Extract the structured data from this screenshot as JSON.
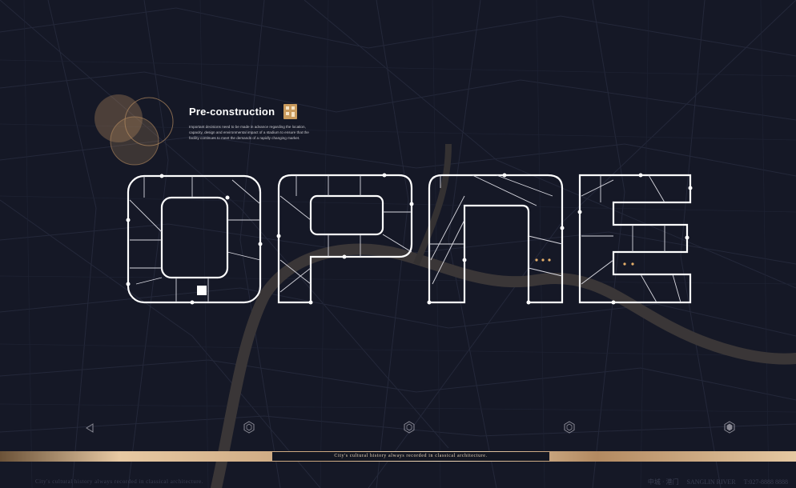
{
  "intro": {
    "title": "Pre-construction",
    "body": "Important decisions need to be made in advance regarding the location, capacity, design and environmental impact of a stadium to ensure that the facility continues to meet the demands of a rapidly changing market."
  },
  "wordmark": {
    "text": "OPNE",
    "stroke_color": "#ffffff"
  },
  "nav": {
    "icons": [
      "arrow-left-icon",
      "hexagon-icon",
      "hexagon-icon",
      "hexagon-icon",
      "hexagon-icon"
    ]
  },
  "band": {
    "text": "City's cultural history always recorded in classical architecture."
  },
  "footer": {
    "left_text": "City's cultural history always recorded in classical architecture.",
    "right_cn": "中城 · 港门",
    "right_mid": "SANGLIN RIVER",
    "right_phone": "T:027-8888 8888"
  },
  "colors": {
    "background": "#151826",
    "map_lines": "#232739",
    "river": "#3d3a3b",
    "gold": "#c99a5c",
    "circle": "#b48a5f"
  }
}
